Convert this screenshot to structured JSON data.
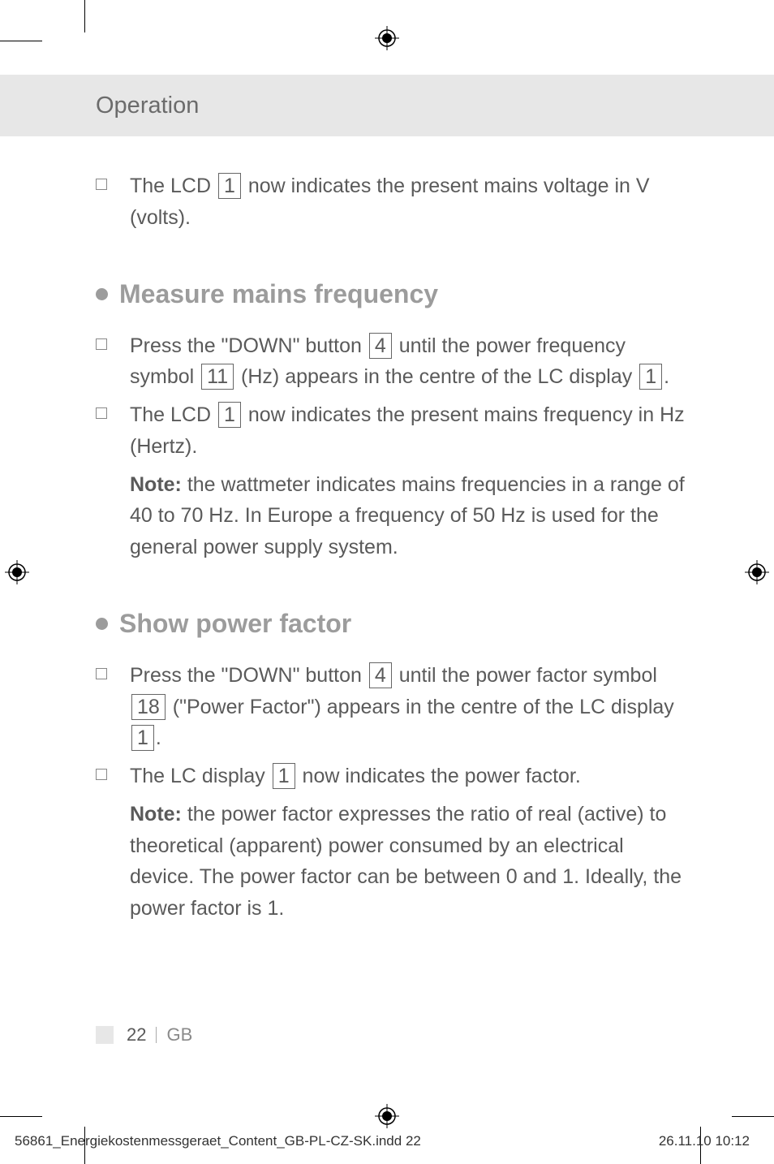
{
  "header": {
    "title": "Operation"
  },
  "intro": {
    "prefix": "The LCD ",
    "box": "1",
    "suffix": " now indicates the present mains voltage in V (volts)."
  },
  "section1": {
    "title": "Measure mains frequency",
    "item1": {
      "t1": "Press the \"DOWN\" button ",
      "b1": "4",
      "t2": " until the power frequency symbol ",
      "b2": "11",
      "t3": " (Hz) appears in the centre of the LC display ",
      "b3": "1",
      "t4": "."
    },
    "item2": {
      "t1": "The LCD ",
      "b1": "1",
      "t2": " now indicates the present mains frequency in Hz (Hertz)."
    },
    "note_label": "Note:",
    "note_text": " the wattmeter indicates mains frequencies in a range of 40 to 70 Hz. In Europe a frequency of 50 Hz is used for the general power supply system."
  },
  "section2": {
    "title": "Show power factor",
    "item1": {
      "t1": "Press the \"DOWN\" button ",
      "b1": "4",
      "t2": " until the power factor symbol ",
      "b2": "18",
      "t3": " (\"Power Factor\") appears in the centre of the LC display ",
      "b3": "1",
      "t4": "."
    },
    "item2": {
      "t1": "The LC display ",
      "b1": "1",
      "t2": " now indicates the power factor."
    },
    "note_label": "Note:",
    "note_text": " the power factor expresses the ratio of real (active) to theoretical (apparent) power consumed by an electrical device. The power factor can be between 0 and 1. Ideally, the power factor is 1."
  },
  "page": {
    "num": "22",
    "region": "GB"
  },
  "footer": {
    "file": "56861_Energiekostenmessgeraet_Content_GB-PL-CZ-SK.indd   22",
    "date": "26.11.10   10:12"
  }
}
